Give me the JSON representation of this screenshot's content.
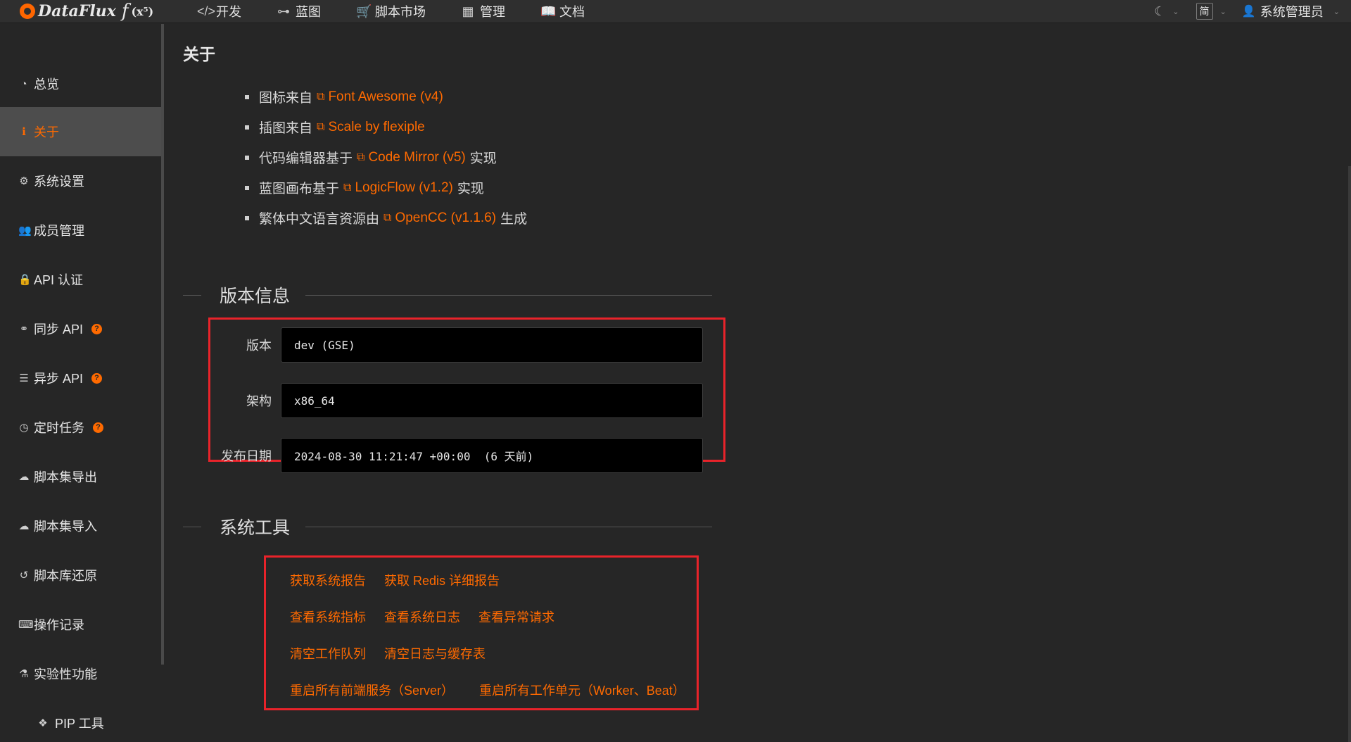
{
  "app": {
    "logo_text": "DataFlux",
    "logo_fx": "f",
    "logo_sup": "(x⁵)"
  },
  "nav": [
    {
      "label": "开发",
      "icon": "code-icon"
    },
    {
      "label": "蓝图",
      "icon": "blueprint-icon"
    },
    {
      "label": "脚本市场",
      "icon": "cart-icon"
    },
    {
      "label": "管理",
      "icon": "grid-icon"
    },
    {
      "label": "文档",
      "icon": "book-icon"
    }
  ],
  "topbar": {
    "theme_icon": "moon-icon",
    "language": "简",
    "user": "系统管理员"
  },
  "sidebar": {
    "items": [
      {
        "label": "总览",
        "icon": "dashboard-icon",
        "active": false
      },
      {
        "label": "关于",
        "icon": "info-icon",
        "active": true
      },
      {
        "label": "系统设置",
        "icon": "gear-icon",
        "active": false
      },
      {
        "label": "成员管理",
        "icon": "users-icon",
        "active": false
      },
      {
        "label": "API 认证",
        "icon": "lock-icon",
        "active": false
      },
      {
        "label": "同步 API",
        "icon": "link-icon",
        "active": false,
        "help": "?"
      },
      {
        "label": "异步 API",
        "icon": "server-icon",
        "active": false,
        "help": "?"
      },
      {
        "label": "定时任务",
        "icon": "clock-icon",
        "active": false,
        "help": "?"
      },
      {
        "label": "脚本集导出",
        "icon": "cloud-download-icon",
        "active": false
      },
      {
        "label": "脚本集导入",
        "icon": "cloud-upload-icon",
        "active": false
      },
      {
        "label": "脚本库还原",
        "icon": "history-icon",
        "active": false
      },
      {
        "label": "操作记录",
        "icon": "keyboard-icon",
        "active": false
      },
      {
        "label": "实验性功能",
        "icon": "flask-icon",
        "active": false
      },
      {
        "label": "PIP 工具",
        "icon": "cubes-icon",
        "active": false
      }
    ]
  },
  "main": {
    "title": "关于",
    "credits": [
      {
        "prefix": "图标来自",
        "link": "Font Awesome (v4)",
        "suffix": ""
      },
      {
        "prefix": "插图来自",
        "link": "Scale by flexiple",
        "suffix": ""
      },
      {
        "prefix": "代码编辑器基于",
        "link": "Code Mirror (v5)",
        "suffix": "实现"
      },
      {
        "prefix": "蓝图画布基于",
        "link": "LogicFlow (v1.2)",
        "suffix": "实现"
      },
      {
        "prefix": "繁体中文语言资源由",
        "link": "OpenCC (v1.1.6)",
        "suffix": "生成"
      }
    ],
    "version_section": {
      "title": "版本信息",
      "fields": [
        {
          "label": "版本",
          "value": "dev (GSE)"
        },
        {
          "label": "架构",
          "value": "x86_64"
        },
        {
          "label": "发布日期",
          "value": "2024-08-30 11:21:47 +00:00  (6 天前)"
        }
      ]
    },
    "tools_section": {
      "title": "系统工具",
      "rows": [
        [
          "获取系统报告",
          "获取 Redis 详细报告"
        ],
        [
          "查看系统指标",
          "查看系统日志",
          "查看异常请求"
        ],
        [
          "清空工作队列",
          "清空日志与缓存表"
        ],
        [
          "重启所有前端服务（Server）",
          "重启所有工作单元（Worker、Beat）"
        ]
      ]
    }
  },
  "colors": {
    "accent": "#ff6a00",
    "highlight_box": "#e8232a",
    "background": "#262626",
    "topbar": "#2f2f2f"
  }
}
